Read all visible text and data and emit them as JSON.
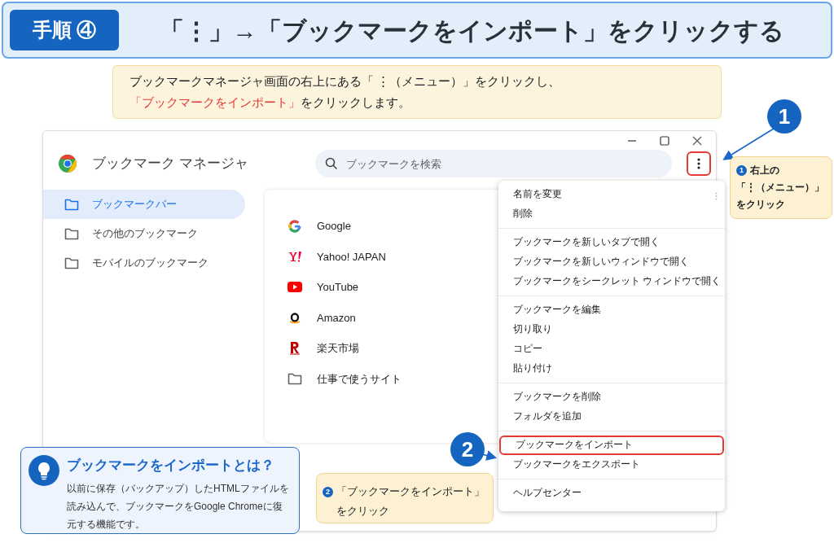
{
  "header": {
    "step": "手順 ④",
    "title": "「⋮」→「ブックマークをインポート」をクリックする"
  },
  "instruction": [
    "ブックマークマネージャ画面の右上にある「 ⋮（メニュー）」をクリックし、",
    "**「ブックマークをインポート」**をクリックします。"
  ],
  "window": {
    "title": "ブックマーク マネージャ",
    "search": {
      "placeholder": "ブックマークを検索"
    },
    "menu_button": {
      "outlined": true
    },
    "sidebar": [
      {
        "label": "ブックマークバー",
        "selected": true
      },
      {
        "label": "その他のブックマーク",
        "selected": false
      },
      {
        "label": "モバイルのブックマーク",
        "selected": false
      }
    ],
    "bookmarks": [
      {
        "kind": "google",
        "title": "Google"
      },
      {
        "kind": "yahoo",
        "title": "Yahoo! JAPAN"
      },
      {
        "kind": "youtube",
        "title": "YouTube"
      },
      {
        "kind": "amazon",
        "title": "Amazon"
      },
      {
        "kind": "rakuten",
        "title": "楽天市場"
      },
      {
        "kind": "folder",
        "title": "仕事で使うサイト"
      }
    ],
    "menu": [
      [
        {
          "label": "名前を変更",
          "outlined": false
        },
        {
          "label": "削除",
          "outlined": false
        }
      ],
      [
        {
          "label": "ブックマークを新しいタブで開く",
          "outlined": false
        },
        {
          "label": "ブックマークを新しいウィンドウで開く",
          "outlined": false
        },
        {
          "label": "ブックマークをシークレット ウィンドウで開く",
          "outlined": false
        }
      ],
      [
        {
          "label": "ブックマークを編集",
          "outlined": false
        },
        {
          "label": "切り取り",
          "outlined": false
        },
        {
          "label": "コピー",
          "outlined": false
        },
        {
          "label": "貼り付け",
          "outlined": false
        }
      ],
      [
        {
          "label": "ブックマークを削除",
          "outlined": false
        },
        {
          "label": "フォルダを追加",
          "outlined": false
        }
      ],
      [
        {
          "label": "ブックマークをインポート",
          "outlined": true
        },
        {
          "label": "ブックマークをエクスポート",
          "outlined": false
        }
      ],
      [
        {
          "label": "ヘルプセンター",
          "outlined": false
        }
      ]
    ]
  },
  "callouts": [
    {
      "badge": "1",
      "mark": "1",
      "lines": [
        "右上の",
        "「⋮（メニュー）」",
        "をクリック"
      ]
    },
    {
      "badge": "2",
      "mark": "2",
      "lines": [
        "「ブックマークをインポート」",
        "をクリック"
      ]
    }
  ],
  "tip": {
    "title": "ブックマークをインポートとは？",
    "body": "以前に保存（バックアップ）したHTMLファイルを読み込んで、ブックマークをGoogle Chromeに復元する機能です。"
  }
}
